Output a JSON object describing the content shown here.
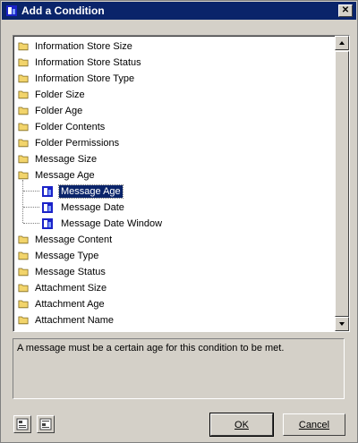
{
  "window": {
    "title": "Add a Condition",
    "close_glyph": "✕"
  },
  "tree": {
    "items": [
      {
        "label": "Information Store Size",
        "type": "folder"
      },
      {
        "label": "Information Store Status",
        "type": "folder"
      },
      {
        "label": "Information Store Type",
        "type": "folder"
      },
      {
        "label": "Folder Size",
        "type": "folder"
      },
      {
        "label": "Folder Age",
        "type": "folder"
      },
      {
        "label": "Folder Contents",
        "type": "folder"
      },
      {
        "label": "Folder Permissions",
        "type": "folder"
      },
      {
        "label": "Message Size",
        "type": "folder"
      },
      {
        "label": "Message Age",
        "type": "folder"
      },
      {
        "label": "Message Age",
        "type": "condition",
        "selected": true
      },
      {
        "label": "Message Date",
        "type": "condition"
      },
      {
        "label": "Message Date Window",
        "type": "condition"
      },
      {
        "label": "Message Content",
        "type": "folder"
      },
      {
        "label": "Message Type",
        "type": "folder"
      },
      {
        "label": "Message Status",
        "type": "folder"
      },
      {
        "label": "Attachment Size",
        "type": "folder"
      },
      {
        "label": "Attachment Age",
        "type": "folder"
      },
      {
        "label": "Attachment Name",
        "type": "folder"
      }
    ]
  },
  "description": "A message must be a certain age for this condition to be met.",
  "buttons": {
    "ok": "OK",
    "cancel": "Cancel"
  },
  "colors": {
    "titlebar": "#0a246a",
    "selection": "#0a246a",
    "folder": "#f2d46b",
    "condition_icon": "#1a22c8"
  }
}
